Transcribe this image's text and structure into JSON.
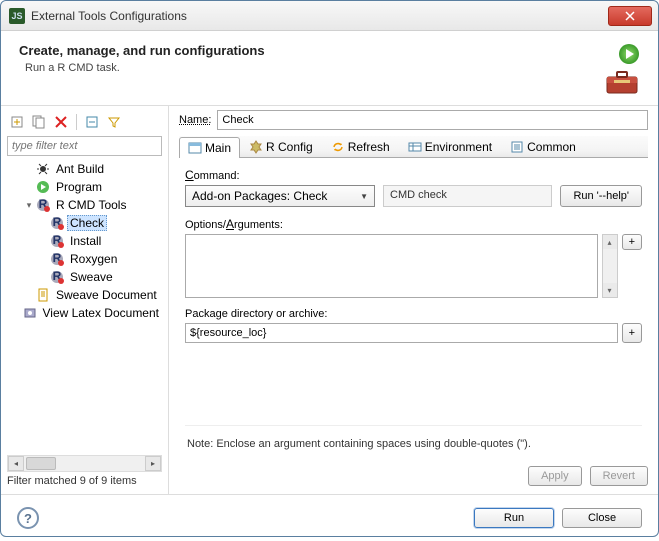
{
  "window": {
    "title": "External Tools Configurations"
  },
  "header": {
    "title": "Create, manage, and run configurations",
    "subtitle": "Run a R CMD task."
  },
  "left": {
    "filter_placeholder": "type filter text",
    "status": "Filter matched 9 of 9 items",
    "tree": {
      "ant": "Ant Build",
      "program": "Program",
      "rcmd": "R CMD Tools",
      "check": "Check",
      "install": "Install",
      "roxygen": "Roxygen",
      "sweave": "Sweave",
      "sweave_doc": "Sweave Document",
      "latex_doc": "View Latex Document"
    }
  },
  "right": {
    "name_label": "Name:",
    "name_value": "Check",
    "tabs": {
      "main": "Main",
      "rconfig": "R Config",
      "refresh": "Refresh",
      "env": "Environment",
      "common": "Common"
    },
    "command_label": "Command:",
    "command_combo": "Add-on Packages: Check",
    "command_ro": "CMD check",
    "run_help": "Run '--help'",
    "options_label": "Options/Arguments:",
    "options_value": "",
    "pkg_label": "Package directory or archive:",
    "pkg_value": "${resource_loc}",
    "note": "Note: Enclose an argument containing spaces using double-quotes (\").",
    "apply": "Apply",
    "revert": "Revert"
  },
  "footer": {
    "run": "Run",
    "close": "Close"
  }
}
